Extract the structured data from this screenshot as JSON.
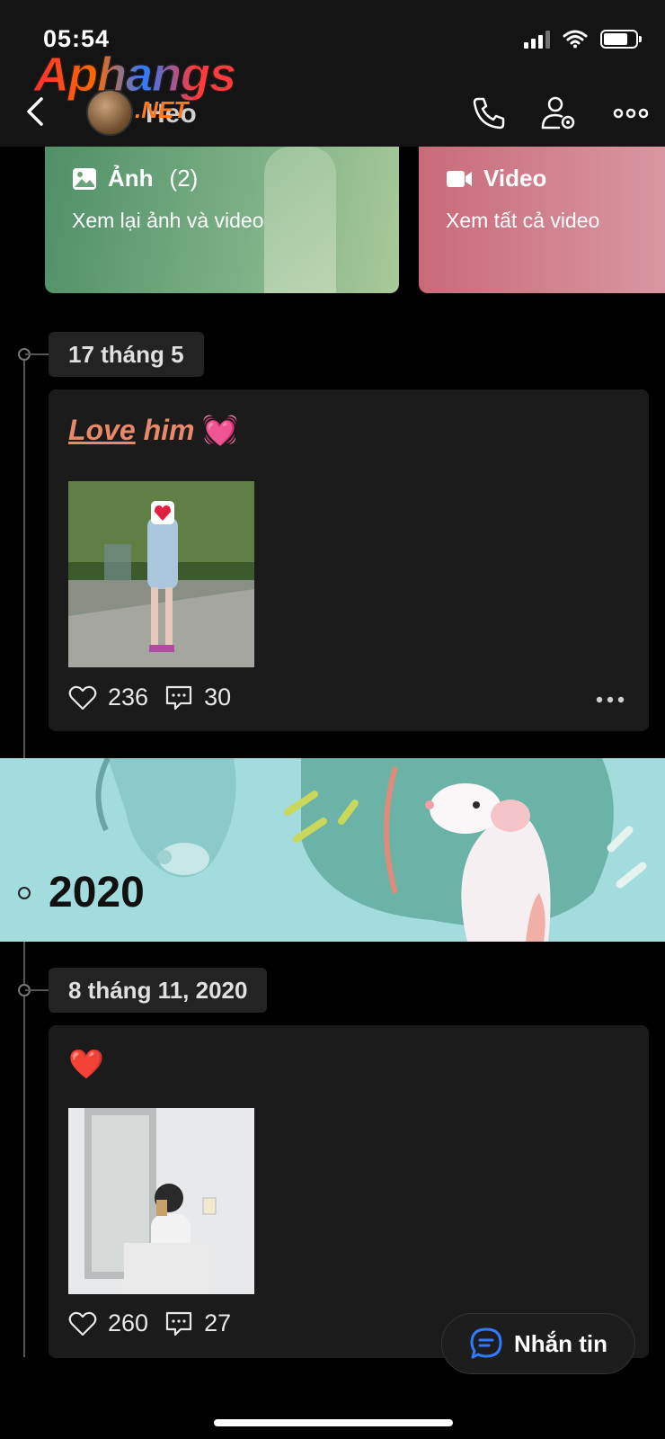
{
  "status_bar": {
    "time": "05:54"
  },
  "header": {
    "profile_name": "Heo",
    "watermark_logo": "Aphangs",
    "watermark_suffix": ".NET",
    "icons": [
      "back-chevron-icon",
      "phone-icon",
      "user-settings-icon",
      "more-icon"
    ]
  },
  "media": {
    "photos": {
      "title": "Ảnh",
      "count": "(2)",
      "subtitle": "Xem lại ảnh và video"
    },
    "videos": {
      "title": "Video",
      "subtitle": "Xem tất cả video"
    }
  },
  "timeline": [
    {
      "date": "17 tháng 5",
      "caption_word1": "Love",
      "caption_word2": "him",
      "caption_emoji": "💓",
      "likes": "236",
      "comments": "30"
    },
    {
      "year_banner": "2020",
      "date": "8 tháng 11, 2020",
      "caption_emoji": "❤️",
      "likes": "260",
      "comments": "27"
    }
  ],
  "chat_button": {
    "label": "Nhắn tin"
  },
  "colors": {
    "background": "#000000",
    "card": "#1b1b1b",
    "accent_blue": "#2f7bff",
    "caption": "#e8896a"
  }
}
